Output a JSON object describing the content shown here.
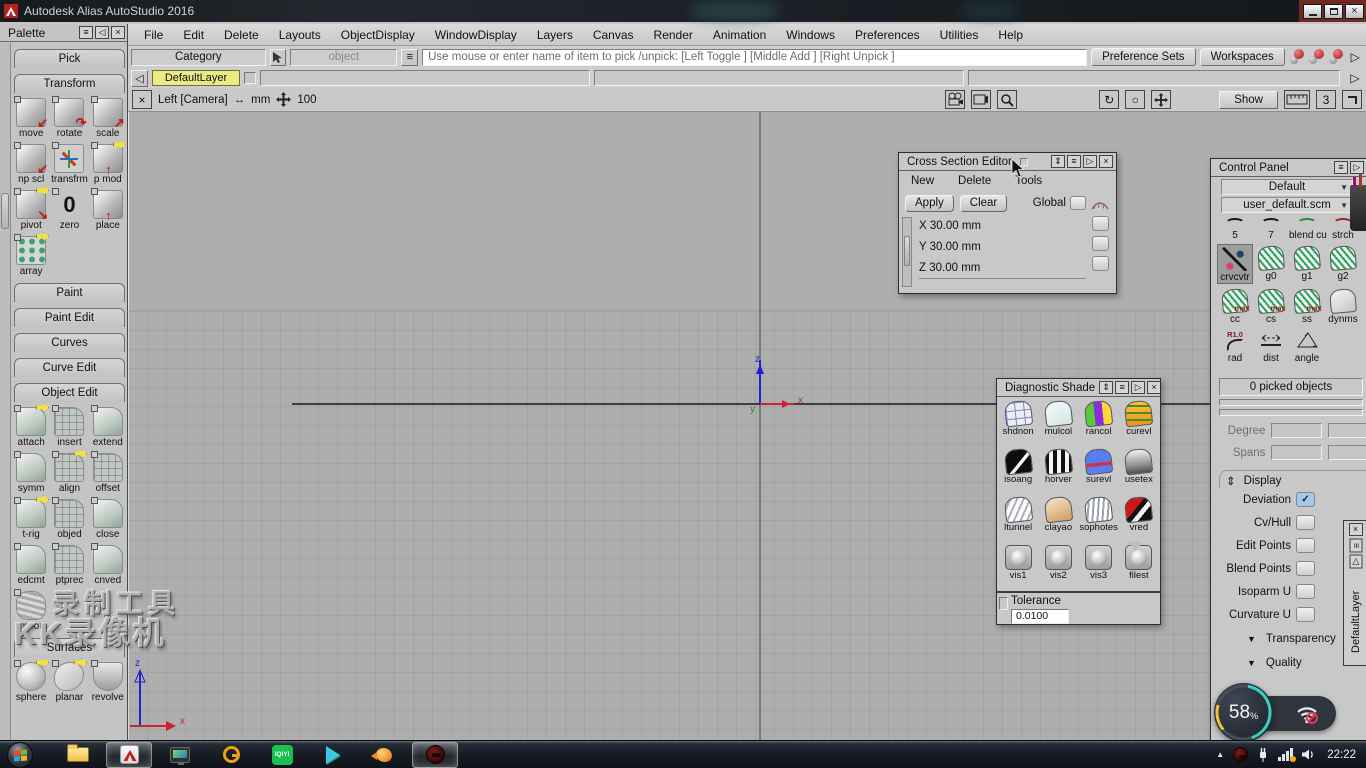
{
  "glyphs": {
    "menu": "≡",
    "left": "◁",
    "right": "▷",
    "play": "▷",
    "close": "×",
    "updown": "⇕",
    "down": "▼",
    "up": "▲",
    "check": "✓",
    "lr": "↔",
    "rotate": "↻",
    "circle": "○"
  },
  "titlebar": {
    "title": "Autodesk Alias AutoStudio 2016"
  },
  "menubar": {
    "items": [
      "File",
      "Edit",
      "Delete",
      "Layouts",
      "ObjectDisplay",
      "WindowDisplay",
      "Layers",
      "Canvas",
      "Render",
      "Animation",
      "Windows",
      "Preferences",
      "Utilities",
      "Help"
    ]
  },
  "toolbar": {
    "category": "Category",
    "object": "object",
    "prompt": "Use mouse or enter name of item to pick /unpick: [Left Toggle ] [Middle Add ] [Right Unpick ]",
    "preference_sets": "Preference Sets",
    "workspaces": "Workspaces"
  },
  "layerbar": {
    "layer": "DefaultLayer"
  },
  "palette": {
    "title": "Palette",
    "tabs": {
      "pick": "Pick",
      "transform": "Transform",
      "paint": "Paint",
      "paint_edit": "Paint Edit",
      "curves": "Curves",
      "curve_edit": "Curve Edit",
      "object_edit": "Object Edit",
      "surfaces": "Surfaces"
    },
    "transform_tools": [
      "move",
      "rotate",
      "scale",
      "np scl",
      "transfrm",
      "p mod",
      "pivot",
      "zero",
      "place",
      "array"
    ],
    "zero_glyph": "0",
    "object_edit_tools": [
      "attach",
      "insert",
      "extend",
      "symm",
      "align",
      "offset",
      "t-rig",
      "objed",
      "close",
      "edcmt",
      "ptprec",
      "cnved",
      "smooth"
    ],
    "surfaces_tools": [
      "sphere",
      "planar",
      "revolve"
    ]
  },
  "viewport": {
    "camera": "Left [Camera]",
    "units": "mm",
    "zoom": "100",
    "show": "Show",
    "cells": "3",
    "axis": {
      "x": "x",
      "y": "y",
      "z": "z"
    }
  },
  "cross_section_editor": {
    "title": "Cross Section Editor",
    "menus": [
      "New",
      "Delete",
      "Tools"
    ],
    "apply": "Apply",
    "clear": "Clear",
    "global": "Global",
    "rows": [
      "X 30.00 mm",
      "Y 30.00 mm",
      "Z 30.00 mm"
    ]
  },
  "diagnostic_shade": {
    "title": "Diagnostic Shade",
    "tools": [
      "shdnon",
      "mulcol",
      "rancol",
      "curevl",
      "isoang",
      "horver",
      "surevl",
      "usetex",
      "ltunnel",
      "clayao",
      "sophotes",
      "vred",
      "vis1",
      "vis2",
      "vis3",
      "filest"
    ],
    "tolerance_label": "Tolerance",
    "tolerance_value": "0.0100"
  },
  "control_panel": {
    "title": "Control Panel",
    "preset": "Default",
    "scheme": "user_default.scm",
    "partial_row": [
      "5",
      "7",
      "blend cu",
      "strch"
    ],
    "row_g": [
      "crvcvtr",
      "g0",
      "g1",
      "g2"
    ],
    "row_c": [
      "cc",
      "cs",
      "ss",
      "dynms"
    ],
    "row_m": [
      "rad",
      "dist",
      "angle"
    ],
    "max_label": "max",
    "rad_label": "R1.0",
    "picked": "0 picked objects",
    "degree": "Degree",
    "spans": "Spans",
    "display": "Display",
    "checks": [
      {
        "label": "Deviation",
        "checked": true
      },
      {
        "label": "Cv/Hull",
        "checked": false
      },
      {
        "label": "Edit Points",
        "checked": false
      },
      {
        "label": "Blend Points",
        "checked": false
      },
      {
        "label": "Isoparm U",
        "checked": false
      },
      {
        "label": "Curvature U",
        "checked": false
      }
    ],
    "transparency": "Transparency",
    "quality": "Quality"
  },
  "side_strip": {
    "title": "DefaultLayer"
  },
  "watermark": {
    "line1": "录制工具",
    "line2": "KK录像机"
  },
  "net_widget": {
    "percent": "58",
    "suffix": "%"
  },
  "taskbar": {
    "time": "22:22",
    "iqiyi": "iQIYI"
  },
  "colors": {
    "accent_yellow": "#eaea86",
    "viewport_gray": "#aeaeae",
    "panel_gray": "#c8c8c8",
    "alias_red": "#b81f1f",
    "check_blue": "#a6c8e8",
    "taskbar_dark": "#161b22"
  }
}
